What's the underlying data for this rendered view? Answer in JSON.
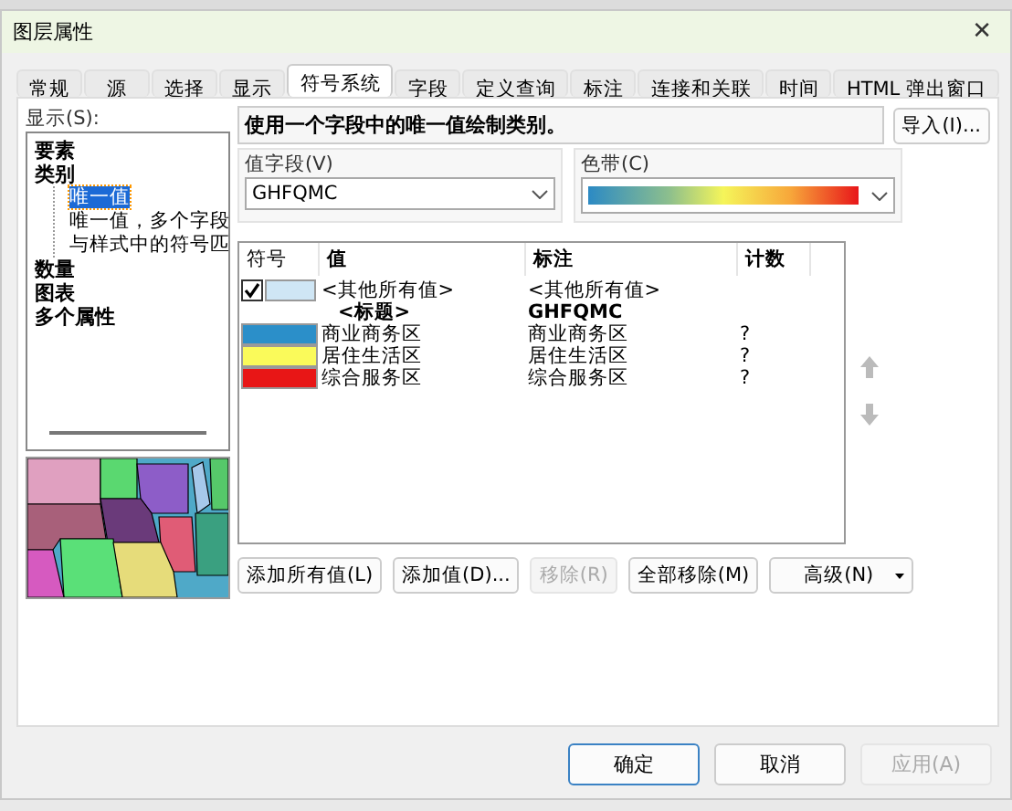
{
  "window": {
    "title": "图层属性",
    "close": "✕"
  },
  "tabs": [
    {
      "label": "常规",
      "selected": false
    },
    {
      "label": "源",
      "selected": false
    },
    {
      "label": "选择",
      "selected": false
    },
    {
      "label": "显示",
      "selected": false
    },
    {
      "label": "符号系统",
      "selected": true
    },
    {
      "label": "字段",
      "selected": false
    },
    {
      "label": "定义查询",
      "selected": false
    },
    {
      "label": "标注",
      "selected": false
    },
    {
      "label": "连接和关联",
      "selected": false
    },
    {
      "label": "时间",
      "selected": false
    },
    {
      "label": "HTML 弹出窗口",
      "selected": false
    }
  ],
  "show": {
    "label": "显示(S):",
    "tree": [
      {
        "label": "要素",
        "selected": false
      },
      {
        "label": "类别",
        "selected": false,
        "children": [
          {
            "label": "唯一值",
            "selected": true
          },
          {
            "label": "唯一值，多个字段",
            "selected": false
          },
          {
            "label": "与样式中的符号匹",
            "selected": false
          }
        ]
      },
      {
        "label": "数量",
        "selected": false
      },
      {
        "label": "图表",
        "selected": false
      },
      {
        "label": "多个属性",
        "selected": false
      }
    ]
  },
  "description": "使用一个字段中的唯一值绘制类别。",
  "import_button": "导入(I)...",
  "value_field": {
    "label": "值字段(V)",
    "value": "GHFQMC"
  },
  "color_ramp": {
    "label": "色带(C)"
  },
  "table": {
    "columns": [
      "符号",
      "值",
      "标注",
      "计数"
    ],
    "rows": [
      {
        "kind": "other",
        "checked": true,
        "color": "#cfe6f5",
        "value": "<其他所有值>",
        "label": "<其他所有值>"
      },
      {
        "kind": "heading",
        "value": "<标题>",
        "label": "GHFQMC"
      },
      {
        "kind": "value",
        "color": "#2b8fc9",
        "value": "商业商务区",
        "label": "商业商务区",
        "count": "?"
      },
      {
        "kind": "value",
        "color": "#fafa5a",
        "value": "居住生活区",
        "label": "居住生活区",
        "count": "?"
      },
      {
        "kind": "value",
        "color": "#e81616",
        "value": "综合服务区",
        "label": "综合服务区",
        "count": "?"
      }
    ]
  },
  "table_buttons": [
    {
      "label": "添加所有值(L)",
      "disabled": false
    },
    {
      "label": "添加值(D)...",
      "disabled": false
    },
    {
      "label": "移除(R)",
      "disabled": true
    },
    {
      "label": "全部移除(M)",
      "disabled": false
    },
    {
      "label": "高级(N)",
      "disabled": false,
      "kind": "menu"
    }
  ],
  "dialog_buttons": [
    {
      "label": "确定",
      "disabled": false,
      "default": true
    },
    {
      "label": "取消",
      "disabled": false,
      "default": false
    },
    {
      "label": "应用(A)",
      "disabled": true,
      "default": false
    }
  ]
}
